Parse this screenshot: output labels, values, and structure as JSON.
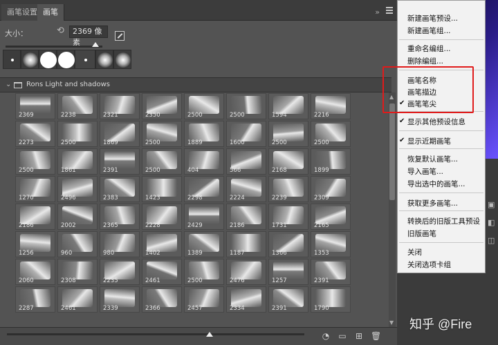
{
  "tabs": [
    {
      "label": "画笔设置"
    },
    {
      "label": "画笔"
    }
  ],
  "tab_controls": "»",
  "size": {
    "label": "大小：",
    "value": "2369 像素",
    "slider_fraction": 0.96
  },
  "folder": {
    "name": "Rons Light and shadows"
  },
  "grid": {
    "rows": [
      [
        "2369",
        "2238",
        "2321",
        "2350",
        "2500",
        "2500",
        "1594",
        "2216"
      ],
      [
        "2273",
        "2500",
        "1869",
        "2500",
        "1889",
        "1600",
        "2500",
        "2500"
      ],
      [
        "2500",
        "1861",
        "2391",
        "2500",
        "404",
        "566",
        "2168",
        "1899"
      ],
      [
        "1270",
        "2496",
        "2383",
        "1423",
        "2298",
        "2224",
        "2239",
        "2309"
      ],
      [
        "2186",
        "2002",
        "2365",
        "2228",
        "2429",
        "2186",
        "1731",
        "2165"
      ],
      [
        "1256",
        "960",
        "980",
        "1402",
        "1389",
        "1187",
        "1366",
        "1353"
      ],
      [
        "2060",
        "2308",
        "2235",
        "2461",
        "2500",
        "2476",
        "1257",
        "2391"
      ],
      [
        "2287",
        "2461",
        "2339",
        "2366",
        "2457",
        "2334",
        "2391",
        "1790"
      ]
    ]
  },
  "menu": {
    "items": [
      {
        "label": "新建画笔预设...",
        "checked": false
      },
      {
        "label": "新建画笔组...",
        "checked": false
      },
      {
        "label": "重命名编组...",
        "checked": false
      },
      {
        "label": "删除编组...",
        "checked": false
      },
      {
        "label": "画笔名称",
        "checked": false
      },
      {
        "label": "画笔描边",
        "checked": false
      },
      {
        "label": "画笔笔尖",
        "checked": true
      },
      {
        "label": "显示其他预设信息",
        "checked": true
      },
      {
        "label": "显示近期画笔",
        "checked": true
      },
      {
        "label": "恢复默认画笔...",
        "checked": false
      },
      {
        "label": "导入画笔...",
        "checked": false
      },
      {
        "label": "导出选中的画笔...",
        "checked": false
      },
      {
        "label": "获取更多画笔...",
        "checked": false
      },
      {
        "label": "转换后的旧版工具预设",
        "checked": false
      },
      {
        "label": "旧版画笔",
        "checked": false
      },
      {
        "label": "关闭",
        "checked": false
      },
      {
        "label": "关闭选项卡组",
        "checked": false
      }
    ]
  },
  "watermark": "知乎 @Fire",
  "colors": {
    "highlight": "#e01b1b",
    "panel": "#535353",
    "menu_bg": "#f2f2f2"
  }
}
